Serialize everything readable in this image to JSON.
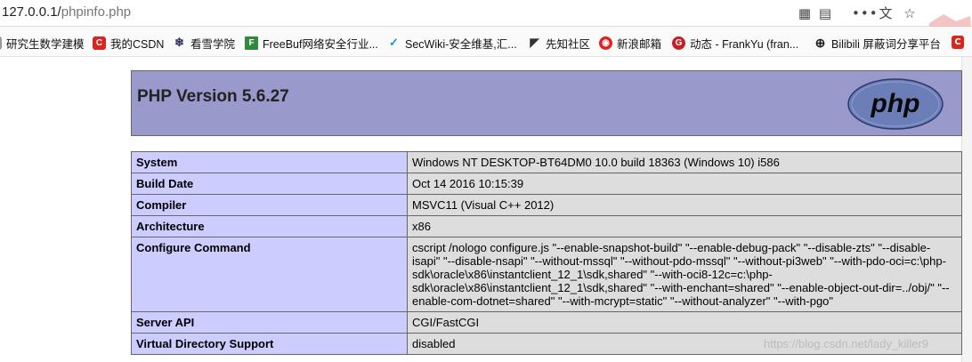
{
  "address_bar": {
    "url_host": "127.0.0.1/",
    "url_path": "phpinfo.php"
  },
  "bookmarks": [
    {
      "label": "研究生数学建模",
      "icon": "bookmark-icon"
    },
    {
      "label": "我的CSDN",
      "icon": "csdn-icon"
    },
    {
      "label": "看雪学院",
      "icon": "snowflake-icon"
    },
    {
      "label": "FreeBuf网络安全行业...",
      "icon": "freebuf-icon"
    },
    {
      "label": "SecWiki-安全维基,汇...",
      "icon": "secwiki-icon"
    },
    {
      "label": "先知社区",
      "icon": "xianzhi-icon"
    },
    {
      "label": "新浪邮箱",
      "icon": "sina-icon"
    },
    {
      "label": "动态 - FrankYu (fran...",
      "icon": "gitee-icon"
    },
    {
      "label": "Bilibili 屏蔽词分享平台",
      "icon": "globe-icon"
    }
  ],
  "php": {
    "version_title": "PHP Version 5.6.27",
    "logo_text": "php",
    "rows": [
      {
        "key": "System",
        "value": "Windows NT DESKTOP-BT64DM0 10.0 build 18363 (Windows 10) i586"
      },
      {
        "key": "Build Date",
        "value": "Oct 14 2016 10:15:39"
      },
      {
        "key": "Compiler",
        "value": "MSVC11 (Visual C++ 2012)"
      },
      {
        "key": "Architecture",
        "value": "x86"
      },
      {
        "key": "Configure Command",
        "value": "cscript /nologo configure.js \"--enable-snapshot-build\" \"--enable-debug-pack\" \"--disable-zts\" \"--disable-isapi\" \"--disable-nsapi\" \"--without-mssql\" \"--without-pdo-mssql\" \"--without-pi3web\" \"--with-pdo-oci=c:\\php-sdk\\oracle\\x86\\instantclient_12_1\\sdk,shared\" \"--with-oci8-12c=c:\\php-sdk\\oracle\\x86\\instantclient_12_1\\sdk,shared\" \"--with-enchant=shared\" \"--enable-object-out-dir=../obj/\" \"--enable-com-dotnet=shared\" \"--with-mcrypt=static\" \"--without-analyzer\" \"--with-pgo\""
      },
      {
        "key": "Server API",
        "value": "CGI/FastCGI"
      },
      {
        "key": "Virtual Directory Support",
        "value": "disabled"
      }
    ]
  },
  "watermark": "https://blog.csdn.net/lady_killer9"
}
